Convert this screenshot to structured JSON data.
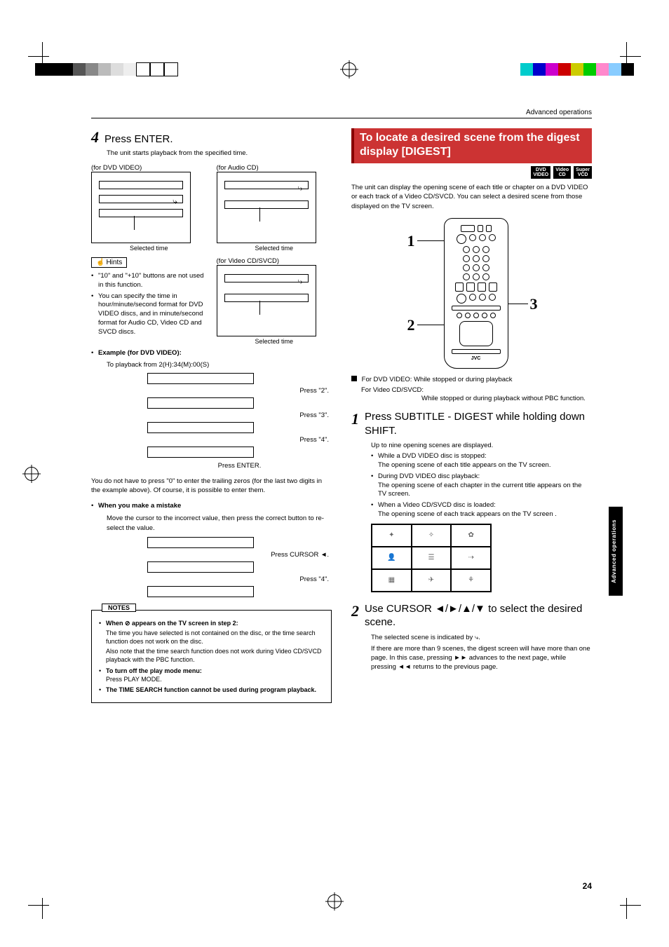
{
  "header": {
    "breadcrumb": "Advanced operations"
  },
  "page_number": "24",
  "side_tab": "Advanced operations",
  "left": {
    "step4": {
      "num": "4",
      "title": "Press ENTER.",
      "sub": "The unit starts playback from the specified time.",
      "panel_dvd_label": "(for DVD VIDEO)",
      "panel_cd_label": "(for Audio CD)",
      "panel_vcd_label": "(for Video CD/SVCD)",
      "selected_time": "Selected time"
    },
    "hints": {
      "tab": "Hints",
      "items": [
        "\"10\" and \"+10\" buttons are not used in this function.",
        "You can specify the time in hour/minute/second format for DVD VIDEO discs, and in minute/second format for Audio CD, Video CD and SVCD discs."
      ]
    },
    "example": {
      "head": "Example (for DVD VIDEO):",
      "sub": "To playback from 2(H):34(M):00(S)",
      "press2": "Press \"2\".",
      "press3": "Press \"3\".",
      "press4": "Press \"4\".",
      "press_enter": "Press ENTER.",
      "para": "You do not have to press \"0\" to enter the trailing zeros (for the last two digits in the example above). Of course, it is possible to enter them."
    },
    "mistake": {
      "head": "When you make a mistake",
      "sub": "Move the cursor to the incorrect value, then press the correct button to re-select the value.",
      "press_cursor": "Press CURSOR ◄.",
      "press4": "Press \"4\"."
    },
    "notes": {
      "tab": "NOTES",
      "n1_head": "When ⊘ appears on the TV screen in step 2:",
      "n1_a": "The time you have selected is not contained on the disc, or the time search function does not work on the disc.",
      "n1_b": "Also note that the time search function does not work during Video CD/SVCD playback with the PBC function.",
      "n2_head": "To turn off the play mode menu:",
      "n2_body": "Press PLAY MODE.",
      "n3": "The TIME SEARCH function cannot be used during program playback."
    }
  },
  "right": {
    "section_title_l1": "To locate a desired scene from the digest",
    "section_title_l2": "display [DIGEST]",
    "badges": [
      "DVD VIDEO",
      "Video CD",
      "Super VCD"
    ],
    "intro": "The unit can display the opening scene of each title or chapter on a DVD VIDEO or each track of a Video CD/SVCD.  You can select a desired scene from those displayed on the TV screen.",
    "remote_nums": {
      "r1": "1",
      "r2": "2",
      "r3": "3"
    },
    "cond_dvd": "For DVD VIDEO:  While stopped or during playback",
    "cond_vcd_label": "For Video CD/SVCD:",
    "cond_vcd_body": "While stopped or during playback without PBC function.",
    "step1": {
      "num": "1",
      "title": "Press SUBTITLE - DIGEST while holding down SHIFT.",
      "sub": "Up to nine opening scenes are displayed.",
      "b1a": "While a DVD VIDEO disc is stopped:",
      "b1b": "The opening scene of each title appears on the TV screen.",
      "b2a": "During DVD VIDEO disc playback:",
      "b2b": "The opening scene of each chapter in the current title appears on the TV screen.",
      "b3a": "When a Video CD/SVCD disc is loaded:",
      "b3b": "The opening scene of each track appears on the TV screen ."
    },
    "step2": {
      "num": "2",
      "title": "Use CURSOR ◄/►/▲/▼ to select the desired scene.",
      "l1": "The selected scene is indicated by ⤷.",
      "l2": "If there are more than 9 scenes, the digest screen will have more than one page. In this case, pressing ►► advances to the next page, while pressing ◄◄ returns to the previous page."
    },
    "remote_brand": "JVC"
  }
}
